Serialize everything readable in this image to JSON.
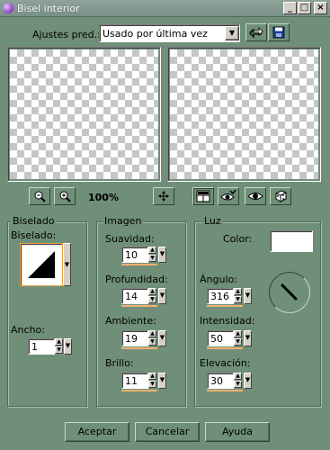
{
  "window": {
    "title": "Bisel interior",
    "minimize": "_",
    "maximize": "□",
    "close": "×"
  },
  "presets": {
    "label": "Ajustes pred.:",
    "value": "Usado por última vez"
  },
  "zoom": {
    "level": "100%"
  },
  "bevel_group": {
    "title": "Biselado",
    "bevel_label": "Biselado:",
    "width_label": "Ancho:",
    "width_value": "1"
  },
  "image_group": {
    "title": "Imagen",
    "smoothness_label": "Suavidad:",
    "smoothness_value": "10",
    "depth_label": "Profundidad:",
    "depth_value": "14",
    "ambient_label": "Ambiente:",
    "ambient_value": "19",
    "brightness_label": "Brillo:",
    "brightness_value": "11"
  },
  "light_group": {
    "title": "Luz",
    "color_label": "Color:",
    "color_value": "#ffffff",
    "angle_label": "Ángulo:",
    "angle_value": "316",
    "intensity_label": "Intensidad:",
    "intensity_value": "50",
    "elevation_label": "Elevación:",
    "elevation_value": "30"
  },
  "actions": {
    "accept": "Aceptar",
    "cancel": "Cancelar",
    "help": "Ayuda"
  }
}
